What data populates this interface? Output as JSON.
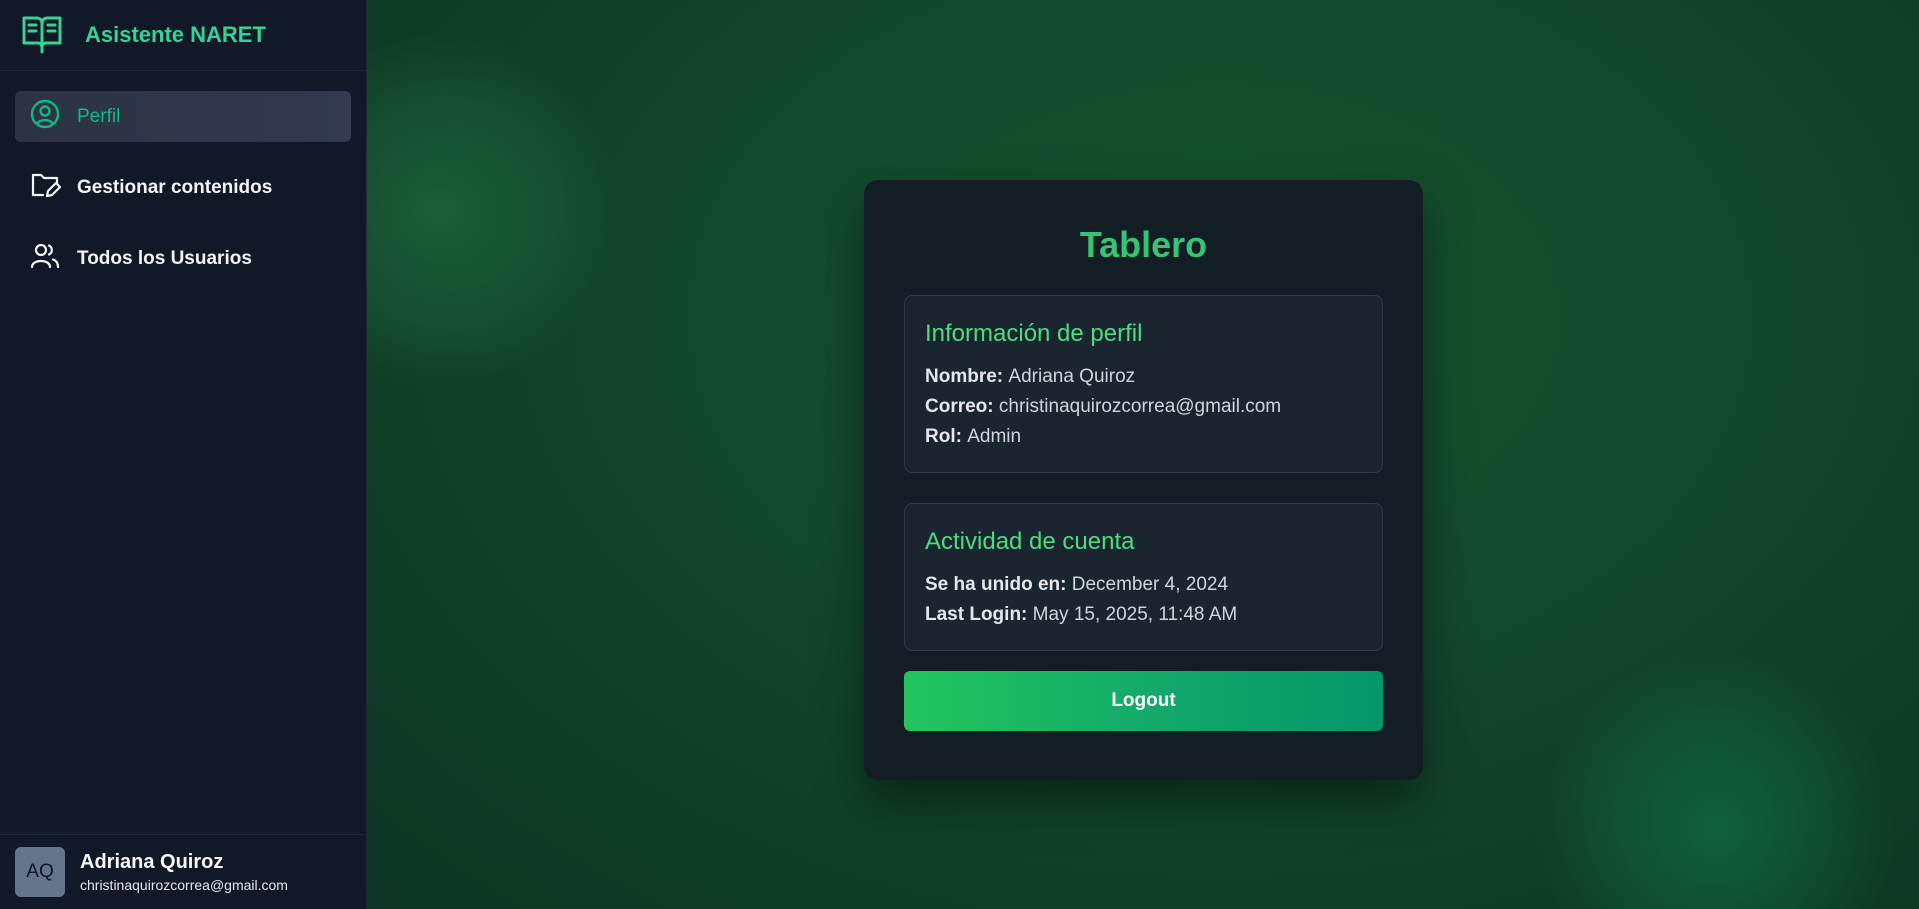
{
  "brand": {
    "name": "Asistente NARET",
    "icon": "book-icon"
  },
  "sidebar": {
    "items": [
      {
        "label": "Perfil",
        "icon": "user-circle-icon",
        "active": true
      },
      {
        "label": "Gestionar contenidos",
        "icon": "folder-edit-icon",
        "active": false
      },
      {
        "label": "Todos los Usuarios",
        "icon": "users-icon",
        "active": false
      }
    ],
    "user": {
      "initials": "AQ",
      "name": "Adriana Quiroz",
      "email": "christinaquirozcorrea@gmail.com"
    }
  },
  "dashboard": {
    "title": "Tablero",
    "profile": {
      "heading": "Información de perfil",
      "name_label": "Nombre:",
      "name_value": "Adriana Quiroz",
      "email_label": "Correo:",
      "email_value": "christinaquirozcorrea@gmail.com",
      "role_label": "Rol:",
      "role_value": "Admin"
    },
    "activity": {
      "heading": "Actividad de cuenta",
      "joined_label": "Se ha unido en:",
      "joined_value": "December 4, 2024",
      "login_label": "Last Login:",
      "login_value": "May 15, 2025, 11:48 AM"
    },
    "logout_label": "Logout"
  },
  "colors": {
    "accent": "#10b981",
    "brand_text": "#34d399",
    "sidebar_bg": "#111827",
    "card_bg": "#131d26",
    "button_start": "#22c55e",
    "button_end": "#059669"
  }
}
